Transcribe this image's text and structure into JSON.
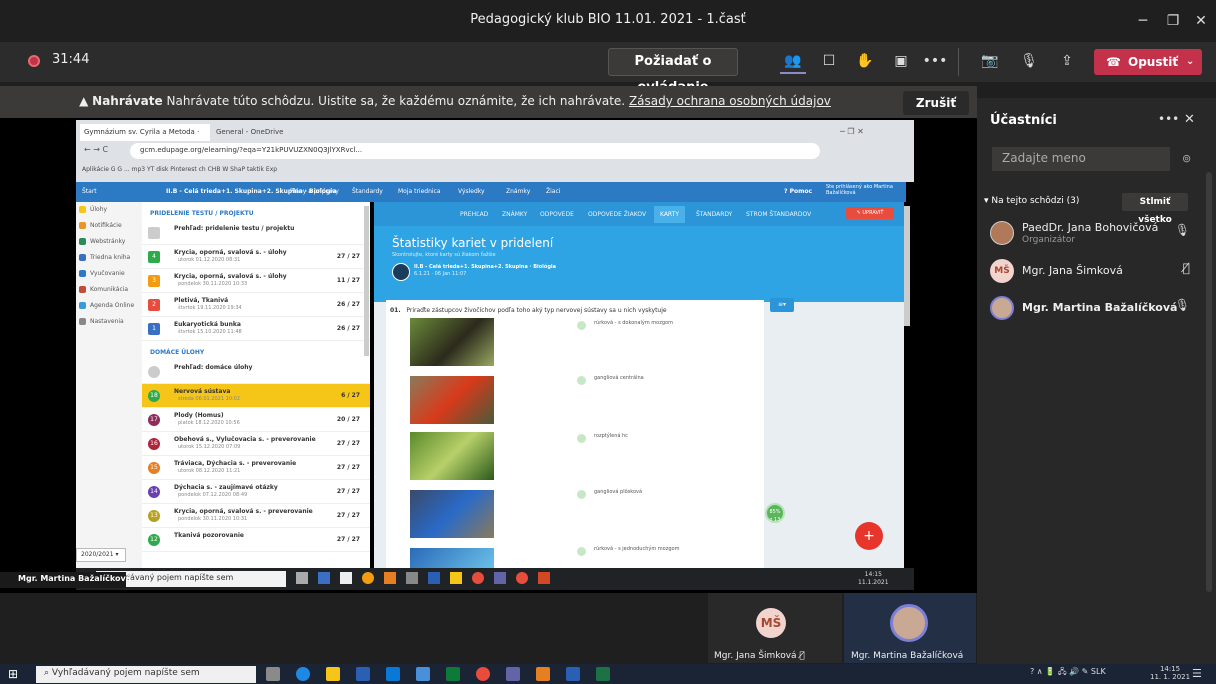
{
  "window": {
    "title": "Pedagogický klub BIO 11.01. 2021 - 1.časť"
  },
  "call": {
    "timer": "31:44",
    "request_control": "Požiadať o ovládanie",
    "leave": "Opustiť"
  },
  "banner": {
    "bold": "Nahrávate",
    "text": "Nahrávate túto schôdzu. Uistite sa, že každému oznámite, že ich nahrávate.",
    "link": "Zásady ochrana osobných údajov",
    "stop": "Zrušiť"
  },
  "browser": {
    "tab1": "Gymnázium sv. Cyrila a Metoda ·",
    "tab2": "General - OneDrive",
    "url": "gcm.edupage.org/elearning/?eqa=Y21kPUVUZXN0Q3JlYXRvcl...",
    "bookmarks": "Aplikácie  G  G  ...  mp3  YT  disk  Pinterest  ch  CHB  W  ShaP  taktik  Exp"
  },
  "edupage": {
    "nav": {
      "home": "Štart",
      "class": "II.B - Celá trieda+1. Skupina+2. Skupina · Biológia",
      "items": [
        "Plány a prípravy",
        "Štandardy",
        "Moja triednica",
        "Výsledky",
        "Známky",
        "Žiaci"
      ],
      "help": "? Pomoc",
      "user": "Ste prihlásený ako Martina Bažalíčková"
    },
    "sidebar": [
      "Úlohy",
      "Notifikácie",
      "Webstránky",
      "Triedna kniha",
      "Vyučovanie",
      "Komunikácia",
      "Agenda Online",
      "Nastavenia"
    ],
    "assigned_header": "PRIDELENIE TESTU / PROJEKTU",
    "homework_header": "DOMÁCE ÚLOHY",
    "year": "2020/2021",
    "tests": [
      {
        "num": "",
        "name": "Prehľad: pridelenie testu / projektu",
        "sub": "",
        "score": ""
      },
      {
        "num": "4",
        "name": "Krycia, oporná, svalová s. - úlohy",
        "sub": "utorok 01.12.2020 08:31",
        "score": "27 / 27"
      },
      {
        "num": "3",
        "name": "Krycia, oporná, svalová s. - úlohy",
        "sub": "pondelok 30.11.2020 10:33",
        "score": "11 / 27"
      },
      {
        "num": "2",
        "name": "Pletivá, Tkanivá",
        "sub": "štvrtok 19.11.2020 19:34",
        "score": "26 / 27"
      },
      {
        "num": "1",
        "name": "Eukaryotická bunka",
        "sub": "štvrtok 15.10.2020 11:48",
        "score": "26 / 27"
      }
    ],
    "homeworks": [
      {
        "num": "",
        "name": "Prehľad: domáce úlohy",
        "sub": "",
        "score": ""
      },
      {
        "num": "18",
        "name": "Nervová sústava",
        "sub": "streda 06.01.2021 10:02",
        "score": "6 / 27"
      },
      {
        "num": "17",
        "name": "Plody (Homus)",
        "sub": "piatok 18.12.2020 10:56",
        "score": "20 / 27"
      },
      {
        "num": "16",
        "name": "Obehová s., Vylučovacia s. - preverovanie",
        "sub": "utorok 15.12.2020 07:09",
        "score": "27 / 27"
      },
      {
        "num": "15",
        "name": "Tráviaca, Dýchacia s. - preverovanie",
        "sub": "utorok 08.12.2020 11:21",
        "score": "27 / 27"
      },
      {
        "num": "14",
        "name": "Dýchacia s. - zaujímavé otázky",
        "sub": "pondelok 07.12.2020 08:49",
        "score": "27 / 27"
      },
      {
        "num": "13",
        "name": "Krycia, oporná, svalová s. - preverovanie",
        "sub": "pondelok 30.11.2020 10:31",
        "score": "27 / 27"
      },
      {
        "num": "12",
        "name": "Tkanivá pozorovanie",
        "sub": "",
        "score": "27 / 27"
      }
    ],
    "tabs": [
      "PREHĽAD",
      "ZNÁMKY",
      "ODPOVEDE",
      "ODPOVEDE ŽIAKOV",
      "KARTY",
      "ŠTANDARDY",
      "STROM ŠTANDARDOV"
    ],
    "edit": "UPRAVIŤ",
    "hero": {
      "title": "Štatistiky kariet v pridelení",
      "sub": "Skontrolujte, ktoré karty sú žiakom ťažšie",
      "class": "II.B - Celá trieda+1. Skupina+2. Skupina · Biológia",
      "date": "6.1.21 · 06 Jan 11:07"
    },
    "question": {
      "num": "01.",
      "text": "Priraďte zástupcov živočíchov podľa toho aký typ nervovej sústavy sa u nich vyskytuje"
    },
    "options": [
      "rúrková - s dokonalým mozgom",
      "gangliová centrálna",
      "rozptýlená hc",
      "gangliová plôsková",
      "rúrková - s jednoduchým mozgom"
    ],
    "percent": "85%",
    "percent_sub": "z 13"
  },
  "inner_taskbar": {
    "search": "Vyhľadávaný pojem napíšte sem",
    "time": "14:15",
    "date": "11.1.2021"
  },
  "speaker_label": "Mgr. Martina Bažalíčková",
  "tiles": [
    {
      "initials": "MŠ",
      "name": "Mgr. Jana Šimková"
    },
    {
      "name": "Mgr. Martina Bažalíčková"
    }
  ],
  "participants": {
    "title": "Účastníci",
    "search_placeholder": "Zadajte meno",
    "in_meeting": "Na tejto schôdzi (3)",
    "mute_all": "Stlmiť všetko",
    "list": [
      {
        "name": "PaedDr. Jana Bohovičová",
        "role": "Organizátor"
      },
      {
        "initials": "MŠ",
        "name": "Mgr. Jana Šimková"
      },
      {
        "name": "Mgr. Martina Bažalíčková"
      }
    ]
  },
  "taskbar": {
    "search": "Vyhľadávaný pojem napíšte sem",
    "lang": "SLK",
    "time": "14:15",
    "date": "11. 1. 2021"
  }
}
